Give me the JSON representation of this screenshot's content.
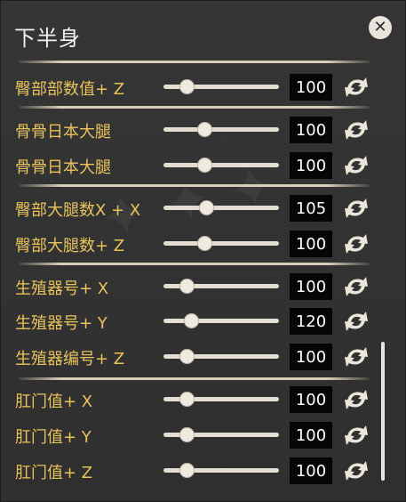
{
  "panel": {
    "title": "下半身",
    "close_icon": "close-icon"
  },
  "rows": [
    {
      "label": "臀部部数值+ Z",
      "value": "100",
      "fraction": 0.2
    },
    {
      "label": "骨骨日本大腿",
      "value": "100",
      "fraction": 0.35
    },
    {
      "label": "骨骨日本大腿",
      "value": "100",
      "fraction": 0.35
    },
    {
      "label": "臀部大腿数X + X",
      "value": "105",
      "fraction": 0.37
    },
    {
      "label": "臀部大腿数+ Z",
      "value": "100",
      "fraction": 0.35
    },
    {
      "label": "生殖器号+ X",
      "value": "100",
      "fraction": 0.2
    },
    {
      "label": "生殖器号+ Y",
      "value": "120",
      "fraction": 0.24
    },
    {
      "label": "生殖器编号+ Z",
      "value": "100",
      "fraction": 0.2
    },
    {
      "label": "肛门值+ X",
      "value": "100",
      "fraction": 0.2
    },
    {
      "label": "肛门值+ Y",
      "value": "100",
      "fraction": 0.2
    },
    {
      "label": "肛门值+ Z",
      "value": "100",
      "fraction": 0.2
    }
  ],
  "colors": {
    "label": "#e8c35c",
    "value_bg": "#050505",
    "track": "#e4ddd2",
    "panel_bg": "#333333"
  },
  "icons": {
    "reset": "reset-arrows-icon",
    "close": "close-icon"
  }
}
